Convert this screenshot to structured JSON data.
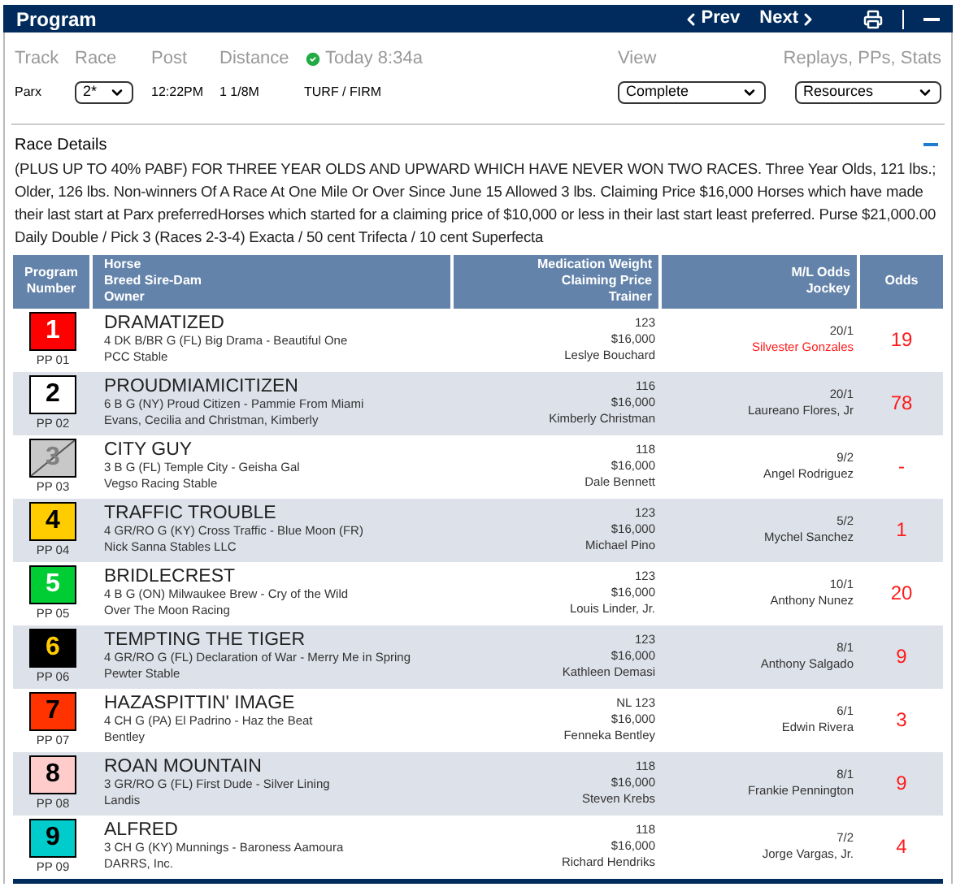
{
  "header": {
    "title": "Program",
    "prev": "Prev",
    "next": "Next"
  },
  "info": {
    "labels": [
      "Track",
      "Race",
      "Post",
      "Distance"
    ],
    "status": "Today 8:34a",
    "track": "Parx",
    "race": "2*",
    "post": "12:22PM",
    "distance": "1 1/8M",
    "surface": "TURF / FIRM",
    "view_label": "View",
    "view_value": "Complete",
    "resources_label": "Replays, PPs, Stats",
    "resources_value": "Resources"
  },
  "race_details": {
    "title": "Race Details",
    "expanded": true,
    "text": "(PLUS UP TO 40% PABF) FOR THREE YEAR OLDS AND UPWARD WHICH HAVE NEVER WON TWO RACES. Three Year Olds, 121 lbs.; Older, 126 lbs. Non-winners Of A Race At One Mile Or Over Since June 15 Allowed 3 lbs. Claiming Price $16,000 Horses which have made their last start at Parx preferredHorses which started for a claiming price of $10,000 or less in their last start least preferred. Purse $21,000.00 Daily Double / Pick 3 (Races 2-3-4) Exacta / 50 cent Trifecta / 10 cent Superfecta"
  },
  "table": {
    "columns": [
      [
        "Program",
        "Number"
      ],
      [
        "Horse",
        "Breed Sire-Dam",
        "Owner"
      ],
      [
        "Medication Weight",
        "Claiming Price",
        "Trainer"
      ],
      [
        "M/L Odds",
        "Jockey"
      ],
      [
        "Odds"
      ]
    ],
    "rows": [
      {
        "number": {
          "text": "1",
          "color": "#ffffff"
        },
        "color": "#ff0000",
        "scratched": false,
        "pp": "PP 01",
        "horse": "DRAMATIZED",
        "breeding": "4 DK B/BR G (FL) Big Drama - Beautiful One",
        "owner": "PCC Stable",
        "weight": "123",
        "price": "$16,000",
        "trainer": "Leslye Bouchard",
        "ml": "20/1",
        "jockey": "Silvester Gonzales",
        "jockey_flagged": true,
        "odds": "19"
      },
      {
        "number": {
          "text": "2",
          "color": "#000000"
        },
        "color": "#ffffff",
        "scratched": false,
        "pp": "PP 02",
        "horse": "PROUDMIAMICITIZEN",
        "breeding": "6 B G (NY) Proud Citizen - Pammie From Miami",
        "owner": "Evans, Cecilia and Christman, Kimberly",
        "weight": "116",
        "price": "$16,000",
        "trainer": "Kimberly Christman",
        "ml": "20/1",
        "jockey": "Laureano Flores, Jr",
        "jockey_flagged": false,
        "odds": "78"
      },
      {
        "number": {
          "text": "3",
          "color": "#808080"
        },
        "color": "#c8c8c8",
        "scratched": true,
        "pp": "PP 03",
        "horse": "CITY GUY",
        "breeding": "3 B G (FL) Temple City - Geisha Gal",
        "owner": "Vegso Racing Stable",
        "weight": "118",
        "price": "$16,000",
        "trainer": "Dale Bennett",
        "ml": "9/2",
        "jockey": "Angel Rodriguez",
        "jockey_flagged": false,
        "odds": "-"
      },
      {
        "number": {
          "text": "4",
          "color": "#000000"
        },
        "color": "#ffcc00",
        "scratched": false,
        "pp": "PP 04",
        "horse": "TRAFFIC TROUBLE",
        "breeding": "4 GR/RO G (KY) Cross Traffic - Blue Moon (FR)",
        "owner": "Nick Sanna Stables LLC",
        "weight": "123",
        "price": "$16,000",
        "trainer": "Michael Pino",
        "ml": "5/2",
        "jockey": "Mychel Sanchez",
        "jockey_flagged": false,
        "odds": "1"
      },
      {
        "number": {
          "text": "5",
          "color": "#ffffff"
        },
        "color": "#00cc33",
        "scratched": false,
        "pp": "PP 05",
        "horse": "BRIDLECREST",
        "breeding": "4 B G (ON) Milwaukee Brew - Cry of the Wild",
        "owner": "Over The Moon Racing",
        "weight": "123",
        "price": "$16,000",
        "trainer": "Louis Linder, Jr.",
        "ml": "10/1",
        "jockey": "Anthony Nunez",
        "jockey_flagged": false,
        "odds": "20"
      },
      {
        "number": {
          "text": "6",
          "color": "#ffcc00"
        },
        "color": "#000000",
        "scratched": false,
        "pp": "PP 06",
        "horse": "TEMPTING THE TIGER",
        "breeding": "4 GR/RO G (FL) Declaration of War - Merry Me in Spring",
        "owner": "Pewter Stable",
        "weight": "123",
        "price": "$16,000",
        "trainer": "Kathleen Demasi",
        "ml": "8/1",
        "jockey": "Anthony Salgado",
        "jockey_flagged": false,
        "odds": "9"
      },
      {
        "number": {
          "text": "7",
          "color": "#000000"
        },
        "color": "#ff3300",
        "scratched": false,
        "pp": "PP 07",
        "horse": "HAZASPITTIN' IMAGE",
        "breeding": "4 CH G (PA) El Padrino - Haz the Beat",
        "owner": "Bentley",
        "weight": "NL 123",
        "price": "$16,000",
        "trainer": "Fenneka Bentley",
        "ml": "6/1",
        "jockey": "Edwin Rivera",
        "jockey_flagged": false,
        "odds": "3"
      },
      {
        "number": {
          "text": "8",
          "color": "#000000"
        },
        "color": "#ffcccc",
        "scratched": false,
        "pp": "PP 08",
        "horse": "ROAN MOUNTAIN",
        "breeding": "3 GR/RO G (FL) First Dude - Silver Lining",
        "owner": "Landis",
        "weight": "118",
        "price": "$16,000",
        "trainer": "Steven Krebs",
        "ml": "8/1",
        "jockey": "Frankie Pennington",
        "jockey_flagged": false,
        "odds": "9"
      },
      {
        "number": {
          "text": "9",
          "color": "#000000"
        },
        "color": "#00cccc",
        "scratched": false,
        "pp": "PP 09",
        "horse": "ALFRED",
        "breeding": "3 CH G (KY) Munnings - Baroness Aamoura",
        "owner": "DARRS, Inc.",
        "weight": "118",
        "price": "$16,000",
        "trainer": "Richard Hendriks",
        "ml": "7/2",
        "jockey": "Jorge Vargas, Jr.",
        "jockey_flagged": false,
        "odds": "4"
      }
    ]
  }
}
